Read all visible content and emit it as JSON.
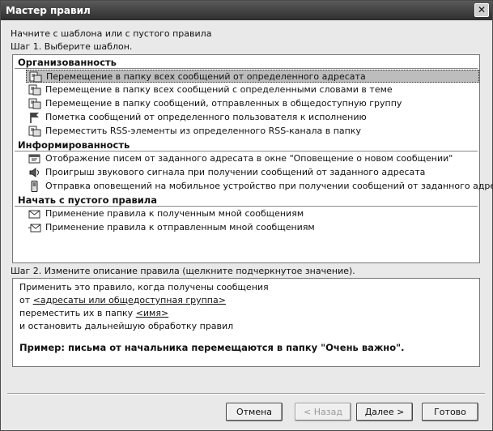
{
  "window": {
    "title": "Мастер правил",
    "close_glyph": "✕"
  },
  "intro": {
    "line1": "Начните с шаблона или с пустого правила",
    "step1": "Шаг 1. Выберите шаблон."
  },
  "groups": [
    {
      "title": "Организованность",
      "items": [
        {
          "label": "Перемещение в папку всех сообщений от определенного адресата",
          "icon": "move-message-icon",
          "selected": true
        },
        {
          "label": "Перемещение в папку всех сообщений с определенными словами в теме",
          "icon": "move-message-icon"
        },
        {
          "label": "Перемещение в папку сообщений, отправленных в общедоступную группу",
          "icon": "move-message-icon"
        },
        {
          "label": "Пометка сообщений от определенного пользователя к исполнению",
          "icon": "flag-icon"
        },
        {
          "label": "Переместить RSS-элементы из определенного RSS-канала в папку",
          "icon": "move-message-icon"
        }
      ]
    },
    {
      "title": "Информированность",
      "items": [
        {
          "label": "Отображение писем от заданного адресата в окне \"Оповещение о новом сообщении\"",
          "icon": "alert-window-icon"
        },
        {
          "label": "Проигрыш звукового сигнала при получении сообщений от заданного адресата",
          "icon": "speaker-icon"
        },
        {
          "label": "Отправка оповещений на мобильное устройство при получении сообщений от заданного адресата",
          "icon": "mobile-icon"
        }
      ]
    },
    {
      "title": "Начать с пустого правила",
      "items": [
        {
          "label": "Применение правила к полученным мной сообщениям",
          "icon": "envelope-icon"
        },
        {
          "label": "Применение правила к отправленным мной сообщениям",
          "icon": "sent-envelope-icon"
        }
      ]
    }
  ],
  "step2": {
    "label": "Шаг 2. Измените описание правила (щелкните подчеркнутое значение).",
    "line1": "Применить это правило, когда получены сообщения",
    "line2_prefix": "от ",
    "line2_link": "<адресаты или общедоступная группа>",
    "line3_prefix": "переместить их в папку ",
    "line3_link": "<имя>",
    "line4": " и остановить дальнейшую обработку правил",
    "example": "Пример: письма от начальника перемещаются в папку \"Очень важно\"."
  },
  "buttons": {
    "cancel": "Отмена",
    "back": "< Назад",
    "next": "Далее >",
    "finish": "Готово"
  }
}
